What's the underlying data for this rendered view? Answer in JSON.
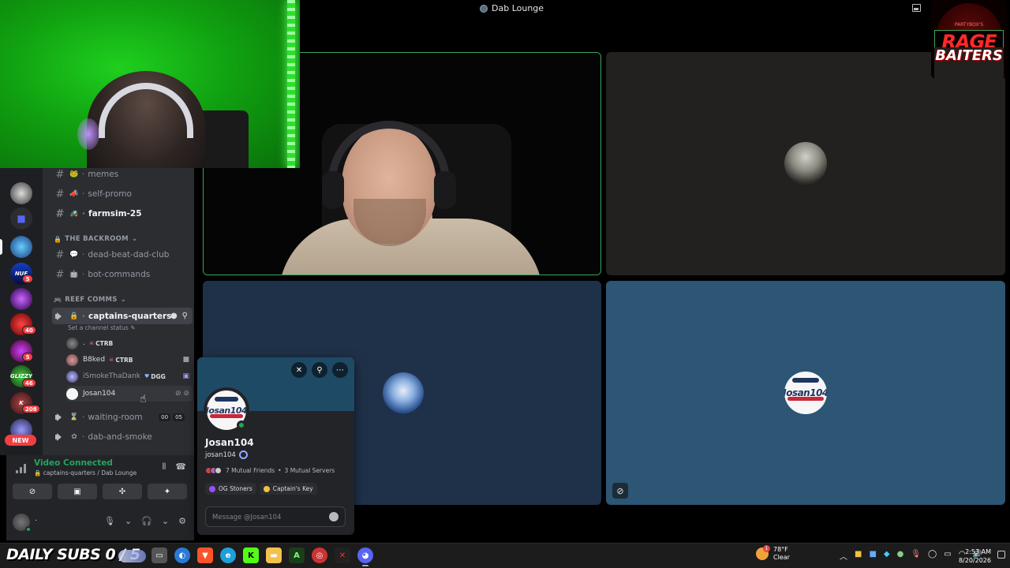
{
  "window": {
    "title": "Dab Lounge"
  },
  "logo": {
    "top_text": "PARTYBOX'S",
    "line1": "RAGE",
    "line2": "BAITERS"
  },
  "rail": {
    "badges": [
      "5",
      "40",
      "5",
      "46",
      "208"
    ],
    "new_label": "NEW"
  },
  "channels": {
    "text": [
      {
        "name": "memes",
        "emoji": "🐸"
      },
      {
        "name": "self-promo",
        "emoji": "📣"
      },
      {
        "name": "farmsim-25",
        "emoji": "🚜"
      }
    ],
    "backroom_category": "THE BACKROOM",
    "backroom": [
      {
        "name": "dead-beat-dad-club",
        "emoji": "💬"
      },
      {
        "name": "bot-commands",
        "emoji": "🤖"
      }
    ],
    "reef_category": "REEF COMMS",
    "active_voice": "captains-quarters",
    "channel_status": "Set a channel status",
    "members": [
      {
        "name": ".",
        "tag": "CTRB"
      },
      {
        "name": "B8ked",
        "tag": "CTRB"
      },
      {
        "name": "iSmokeThaDank",
        "tag": "DGG"
      },
      {
        "name": "Josan104",
        "tag": ""
      }
    ],
    "waiting_room": "waiting-room",
    "waiting_counts": [
      "00",
      "05"
    ],
    "dab_and_smoke": "dab-and-smoke"
  },
  "voice_panel": {
    "status": "Video Connected",
    "location": "captains-quarters / Dab Lounge"
  },
  "user_panel": {
    "name": "."
  },
  "profile": {
    "display_name": "Josan104",
    "username": "josan104",
    "mutual_friends": "7 Mutual Friends",
    "mutual_servers": "3 Mutual Servers",
    "roles": [
      {
        "name": "OG Stoners",
        "color": "#9b4dff"
      },
      {
        "name": "Captain's Key",
        "color": "#f0c040"
      }
    ],
    "message_placeholder": "Message @Josan104"
  },
  "tiles": {
    "avatar_text": "Josan104"
  },
  "taskbar": {
    "subs_label": "DAILY SUBS 0 / 5",
    "weather_temp": "78°F",
    "weather_desc": "Clear",
    "weather_badge": "1",
    "time": "2:53 AM",
    "date": "8/20/2026"
  },
  "colors": {
    "accent_green": "#23a55a",
    "speaking_border": "#3ba55c",
    "discord_blurple": "#5865f2"
  }
}
